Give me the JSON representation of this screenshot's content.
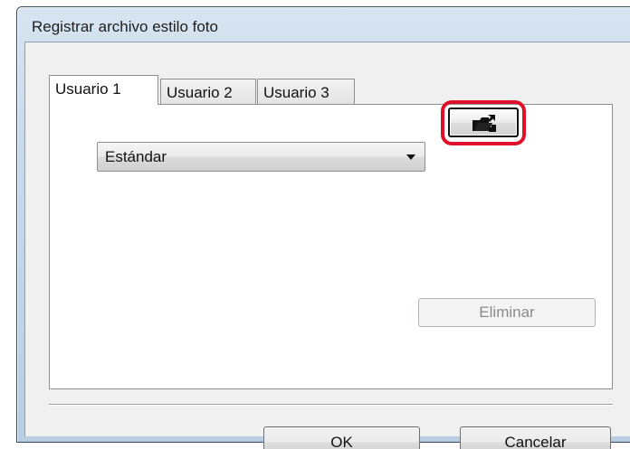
{
  "window": {
    "title": "Registrar archivo estilo foto"
  },
  "tabs": [
    {
      "label": "Usuario 1",
      "active": true
    },
    {
      "label": "Usuario 2",
      "active": false
    },
    {
      "label": "Usuario 3",
      "active": false
    }
  ],
  "style_select": {
    "value": "Estándar"
  },
  "open_file_button": {
    "icon": "open-folder-icon",
    "highlight_color": "#e0102a"
  },
  "delete_button": {
    "label": "Eliminar",
    "enabled": false
  },
  "footer": {
    "ok_label": "OK",
    "cancel_label": "Cancelar"
  }
}
